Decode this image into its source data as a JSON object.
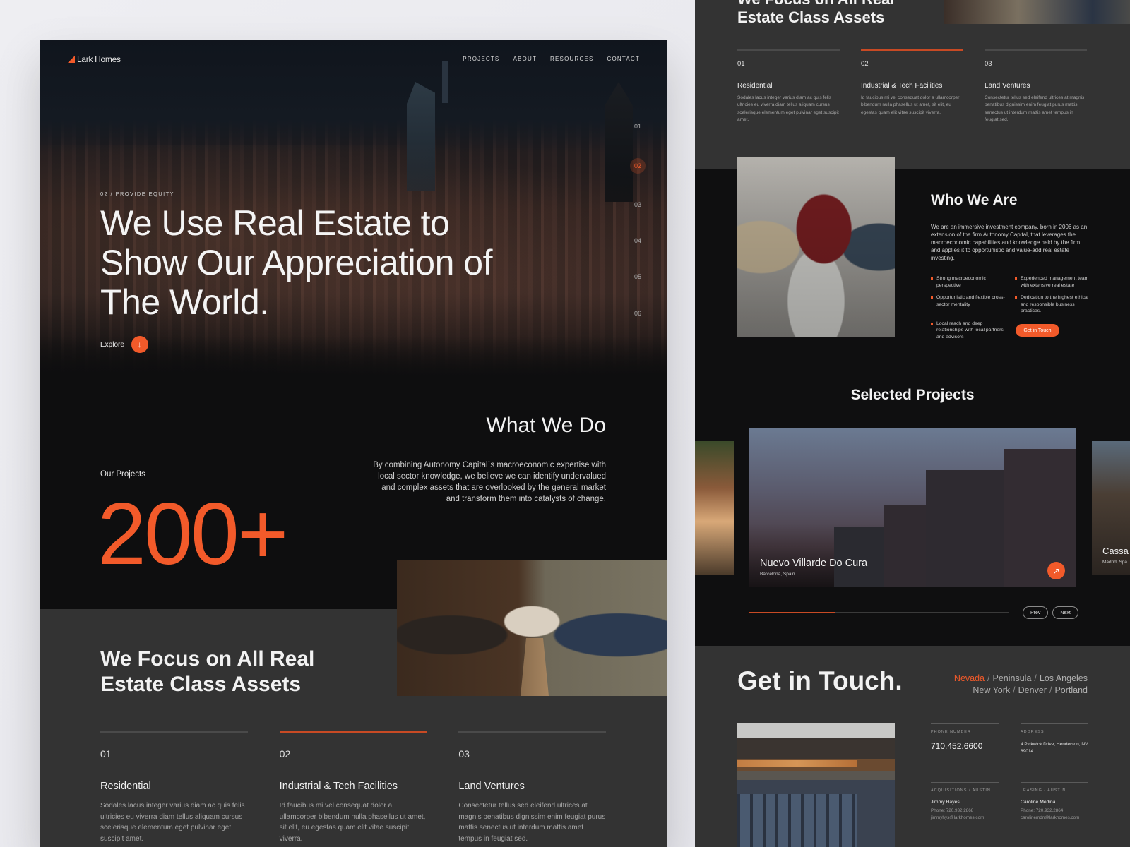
{
  "brand": {
    "name": "Lark Homes",
    "accent": "#f25a2a"
  },
  "nav": {
    "items": [
      "PROJECTS",
      "ABOUT",
      "RESOURCES",
      "CONTACT"
    ]
  },
  "hero": {
    "eyebrow": "02 / PROVIDE EQUITY",
    "title": "We Use Real Estate to Show Our Appreciation of The World.",
    "explore_label": "Explore",
    "slides": [
      "01",
      "02",
      "03",
      "04",
      "05",
      "06"
    ],
    "active_slide": "02"
  },
  "what_we_do": {
    "title": "What We Do",
    "text": "By combining Autonomy Capital´s macroeconomic expertise with local sector knowledge, we believe we can identify undervalued and complex assets that are overlooked by the general market and transform them into catalysts of change."
  },
  "projects": {
    "label": "Our Projects",
    "count": "200+"
  },
  "focus": {
    "title": "We Focus on All Real Estate Class Assets",
    "title_short": "We Focus on All Real Estate Class Assets",
    "columns": [
      {
        "num": "01",
        "title": "Residential",
        "text": "Sodales lacus integer varius diam ac quis felis ultricies eu viverra diam tellus aliquam cursus scelerisque elementum eget pulvinar eget suscipit amet.",
        "active": false
      },
      {
        "num": "02",
        "title": "Industrial & Tech Facilities",
        "text": "Id faucibus mi vel consequat dolor a ullamcorper bibendum nulla phasellus ut amet, sit elit, eu egestas quam elit vitae suscipit viverra.",
        "active": true
      },
      {
        "num": "03",
        "title": "Land Ventures",
        "text": "Consectetur tellus sed eleifend ultrices at magnis penatibus dignissim enim feugiat purus mattis senectus ut interdum mattis amet tempus in feugiat sed.",
        "active": false
      }
    ]
  },
  "who_we_are": {
    "title": "Who We Are",
    "text": "We are an immersive investment company, born in 2006 as an extension of the firm Autonomy Capital, that leverages the macroeconomic capabilities and knowledge held by the firm and applies it to opportunistic and value-add real estate investing.",
    "bullets": [
      "Strong macroeconomic perspective",
      "Experienced management team with extensive real estate",
      "Opportunistic and flexible cross-sector mentality",
      "Dedication to the highest ethical and responsible business practices.",
      "Local reach and deep relationships with local partners and advisors"
    ],
    "cta_label": "Get in Touch"
  },
  "selected_projects": {
    "title": "Selected Projects",
    "current": {
      "name": "Nuevo Villarde Do Cura",
      "location": "Barcelona, Spain"
    },
    "next": {
      "name": "Cassa",
      "location": "Madrid, Spa"
    },
    "progress": 0.33,
    "prev_label": "Prev",
    "next_label": "Next"
  },
  "contact": {
    "title": "Get in Touch.",
    "cities": [
      "Nevada",
      "Peninsula",
      "Los Angeles",
      "New York",
      "Denver",
      "Portland"
    ],
    "active_city": "Nevada",
    "phone_label": "PHONE NUMBER",
    "phone": "710.452.6600",
    "address_label": "ADDRESS",
    "address": "4 Pickwick Drive, Henderson, NV 89014",
    "acq_label": "ACQUISITIONS / AUSTIN",
    "acq_name": "Jimmy Hayes",
    "acq_phone": "Phone: 720.932.2868",
    "acq_email": "jimmyhys@larkhomes.com",
    "leasing_label": "LEASING / AUSTIN",
    "leasing_name": "Caroline Medina",
    "leasing_phone": "Phone: 720.932.2864",
    "leasing_email": "carolinemdn@larkhomes.com"
  }
}
